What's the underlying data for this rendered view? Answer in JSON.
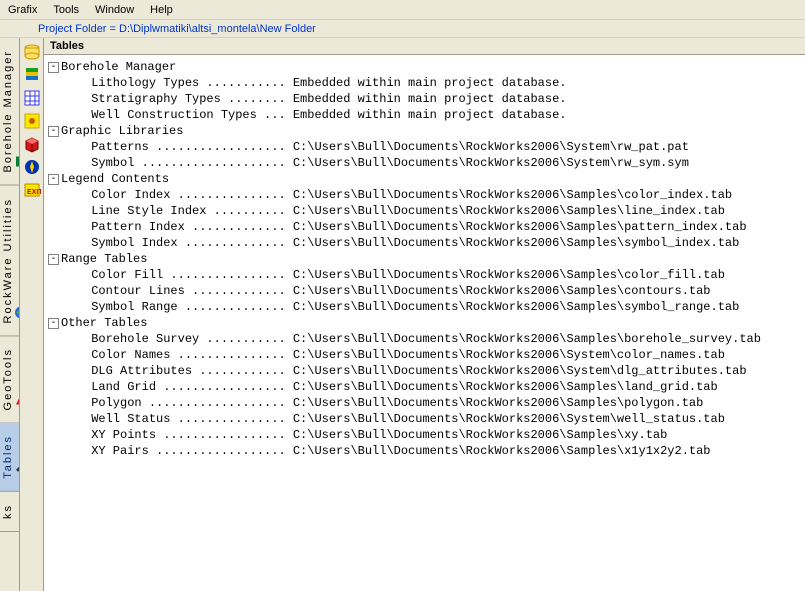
{
  "menubar": {
    "items": [
      "Grafix",
      "Tools",
      "Window",
      "Help"
    ]
  },
  "project": {
    "label": "Project Folder = D:\\Diplwmatiki\\altsi_montela\\New Folder"
  },
  "side_tabs": {
    "items": [
      {
        "label": "Borehole Manager",
        "active": false
      },
      {
        "label": "RockWare Utilities",
        "active": false
      },
      {
        "label": "GeoTools",
        "active": false
      },
      {
        "label": "Tables",
        "active": true
      },
      {
        "label": "ks",
        "active": false
      }
    ]
  },
  "section": {
    "title": "Tables"
  },
  "tree": {
    "groups": [
      {
        "label": "Borehole Manager",
        "items": [
          {
            "name": "Lithology Types",
            "dots": "...........",
            "value": "Embedded within main project database."
          },
          {
            "name": "Stratigraphy Types",
            "dots": "........",
            "value": "Embedded within main project database."
          },
          {
            "name": "Well Construction Types",
            "dots": "...",
            "value": "Embedded within main project database."
          }
        ]
      },
      {
        "label": "Graphic Libraries",
        "items": [
          {
            "name": "Patterns",
            "dots": "..................",
            "value": "C:\\Users\\Bull\\Documents\\RockWorks2006\\System\\rw_pat.pat"
          },
          {
            "name": "Symbol",
            "dots": "....................",
            "value": "C:\\Users\\Bull\\Documents\\RockWorks2006\\System\\rw_sym.sym"
          }
        ]
      },
      {
        "label": "Legend Contents",
        "items": [
          {
            "name": "Color Index",
            "dots": "...............",
            "value": "C:\\Users\\Bull\\Documents\\RockWorks2006\\Samples\\color_index.tab"
          },
          {
            "name": "Line Style Index",
            "dots": "..........",
            "value": "C:\\Users\\Bull\\Documents\\RockWorks2006\\Samples\\line_index.tab"
          },
          {
            "name": "Pattern Index",
            "dots": ".............",
            "value": "C:\\Users\\Bull\\Documents\\RockWorks2006\\Samples\\pattern_index.tab"
          },
          {
            "name": "Symbol Index",
            "dots": "..............",
            "value": "C:\\Users\\Bull\\Documents\\RockWorks2006\\Samples\\symbol_index.tab"
          }
        ]
      },
      {
        "label": "Range Tables",
        "items": [
          {
            "name": "Color Fill",
            "dots": "................",
            "value": "C:\\Users\\Bull\\Documents\\RockWorks2006\\Samples\\color_fill.tab"
          },
          {
            "name": "Contour Lines",
            "dots": ".............",
            "value": "C:\\Users\\Bull\\Documents\\RockWorks2006\\Samples\\contours.tab"
          },
          {
            "name": "Symbol Range",
            "dots": "..............",
            "value": "C:\\Users\\Bull\\Documents\\RockWorks2006\\Samples\\symbol_range.tab"
          }
        ]
      },
      {
        "label": "Other Tables",
        "items": [
          {
            "name": "Borehole Survey",
            "dots": "...........",
            "value": "C:\\Users\\Bull\\Documents\\RockWorks2006\\Samples\\borehole_survey.tab"
          },
          {
            "name": "Color Names",
            "dots": "...............",
            "value": "C:\\Users\\Bull\\Documents\\RockWorks2006\\System\\color_names.tab"
          },
          {
            "name": "DLG Attributes",
            "dots": "............",
            "value": "C:\\Users\\Bull\\Documents\\RockWorks2006\\System\\dlg_attributes.tab"
          },
          {
            "name": "Land Grid",
            "dots": ".................",
            "value": "C:\\Users\\Bull\\Documents\\RockWorks2006\\Samples\\land_grid.tab"
          },
          {
            "name": "Polygon",
            "dots": "...................",
            "value": "C:\\Users\\Bull\\Documents\\RockWorks2006\\Samples\\polygon.tab"
          },
          {
            "name": "Well Status",
            "dots": "...............",
            "value": "C:\\Users\\Bull\\Documents\\RockWorks2006\\System\\well_status.tab"
          },
          {
            "name": "XY Points",
            "dots": ".................",
            "value": "C:\\Users\\Bull\\Documents\\RockWorks2006\\Samples\\xy.tab"
          },
          {
            "name": "XY Pairs",
            "dots": "..................",
            "value": "C:\\Users\\Bull\\Documents\\RockWorks2006\\Samples\\x1y1x2y2.tab"
          }
        ]
      }
    ]
  },
  "toolbar_icons": [
    "database-icon",
    "lithology-icon",
    "grid-icon",
    "yellow-app-icon",
    "block-icon",
    "compass-icon",
    "exit-icon"
  ]
}
